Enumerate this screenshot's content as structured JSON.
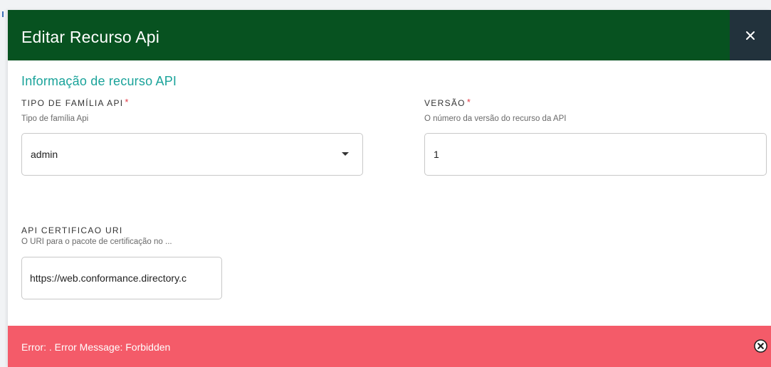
{
  "modal": {
    "title": "Editar Recurso Api",
    "close_icon": "close-icon"
  },
  "form": {
    "section_title": "Informação de recurso API",
    "api_family": {
      "label": "TIPO DE FAMÍLIA API",
      "required_mark": "*",
      "help": "Tipo de família Api",
      "value": "admin"
    },
    "version": {
      "label": "VERSÃO",
      "required_mark": "*",
      "help": "O número da versão do recurso da API",
      "value": "1"
    },
    "cert_uri": {
      "label": "API CERTIFICAO URI",
      "help": "O URI para o pacote de certificação no ...",
      "value": "https://web.conformance.directory.c"
    }
  },
  "alert": {
    "message": "Error: . Error Message: Forbidden",
    "close_icon": "circle-x-icon"
  },
  "colors": {
    "header_bg": "#075220",
    "close_bg": "#22323c",
    "section_title": "#1aa39a",
    "required": "#e23a45",
    "alert_bg": "#f45b69"
  }
}
